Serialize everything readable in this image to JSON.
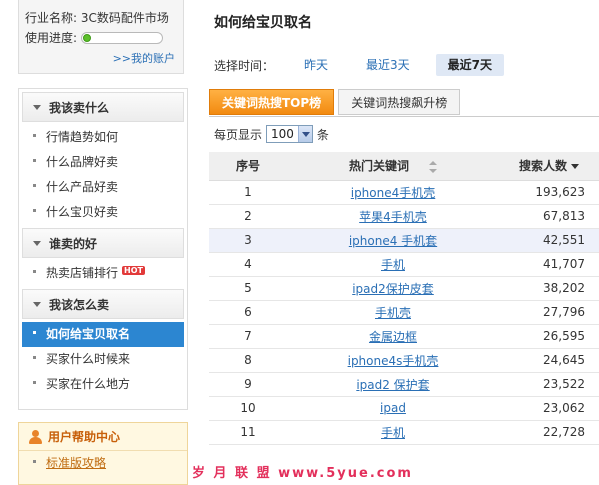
{
  "account": {
    "industry_label": "行业名称:",
    "industry_value": "3C数码配件市场",
    "progress_label": "使用进度:",
    "progress_fraction": 0.0,
    "my_account_link": ">>我的账户"
  },
  "menu": {
    "sections": [
      {
        "title": "我该卖什么",
        "items": [
          "行情趋势如何",
          "什么品牌好卖",
          "什么产品好卖",
          "什么宝贝好卖"
        ]
      },
      {
        "title": "谁卖的好",
        "items": [
          "热卖店铺排行"
        ],
        "hot_badge": "HOT"
      },
      {
        "title": "我该怎么卖",
        "items": [
          "如何给宝贝取名",
          "买家什么时候来",
          "买家在什么地方"
        ],
        "active_index": 0
      }
    ]
  },
  "help": {
    "title": "用户帮助中心",
    "items": [
      "标准版攻略"
    ]
  },
  "main": {
    "title": "如何给宝贝取名",
    "time_label": "选择时间：",
    "time_options": [
      "昨天",
      "最近3天",
      "最近7天"
    ],
    "time_active_index": 2,
    "tabs": [
      "关键词热搜TOP榜",
      "关键词热搜飙升榜"
    ],
    "tab_active_index": 0,
    "per_page_label": "每页显示",
    "per_page_value": "100",
    "per_page_unit": "条"
  },
  "table": {
    "headers": [
      "序号",
      "热门关键词",
      "搜索人数"
    ],
    "rows": [
      {
        "rank": "1",
        "keyword": "iphone4手机壳",
        "count": "193,623"
      },
      {
        "rank": "2",
        "keyword": "苹果4手机壳",
        "count": "67,813"
      },
      {
        "rank": "3",
        "keyword": "iphone4 手机套",
        "count": "42,551"
      },
      {
        "rank": "4",
        "keyword": "手机",
        "count": "41,707"
      },
      {
        "rank": "5",
        "keyword": "ipad2保护皮套",
        "count": "38,202"
      },
      {
        "rank": "6",
        "keyword": "手机壳",
        "count": "27,796"
      },
      {
        "rank": "7",
        "keyword": "金属边框",
        "count": "26,595"
      },
      {
        "rank": "8",
        "keyword": "iphone4s手机壳",
        "count": "24,645"
      },
      {
        "rank": "9",
        "keyword": "ipad2 保护套",
        "count": "23,522"
      },
      {
        "rank": "10",
        "keyword": "ipad",
        "count": "23,062"
      },
      {
        "rank": "11",
        "keyword": "手机",
        "count": "22,728"
      }
    ],
    "highlight_row_index": 2
  },
  "watermark": "岁 月 联 盟  www.5yue.com",
  "colors": {
    "link_blue": "#2a6fb5",
    "active_menu_bg": "#2c86d1",
    "active_tab_orange": "#f28a10",
    "hot_red": "#e23a3a",
    "progress_green": "#5cbf2a"
  }
}
